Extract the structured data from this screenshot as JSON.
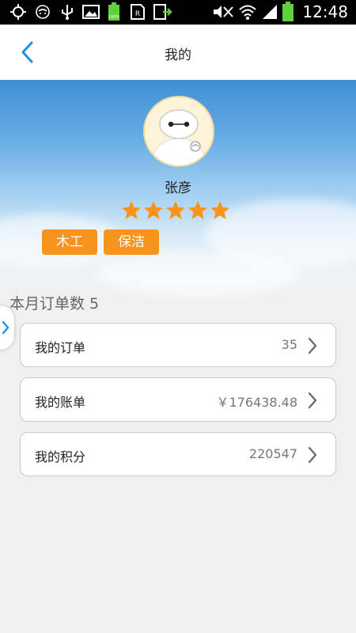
{
  "status_bar": {
    "time": "12:48",
    "battery_level_label": "100%",
    "icons": [
      "gps-icon",
      "face-icon",
      "usb-icon",
      "image-icon",
      "battery-full-small-icon",
      "sim-icon",
      "export-icon",
      "mute-icon",
      "wifi-icon",
      "signal-icon",
      "battery-icon"
    ]
  },
  "header": {
    "title": "我的",
    "back_icon": "chevron-left-icon"
  },
  "profile": {
    "name": "张彦",
    "rating": 5,
    "rating_max": 5,
    "tags": [
      "木工",
      "保洁"
    ]
  },
  "summary": {
    "month_orders_label": "本月订单数 5"
  },
  "items": [
    {
      "label": "我的订单",
      "value": "35"
    },
    {
      "label": "我的账单",
      "value": "￥176438.48"
    },
    {
      "label": "我的积分",
      "value": "220547"
    }
  ],
  "colors": {
    "accent": "#1e8fe1",
    "tag": "#f7941d",
    "star": "#f7941d"
  }
}
